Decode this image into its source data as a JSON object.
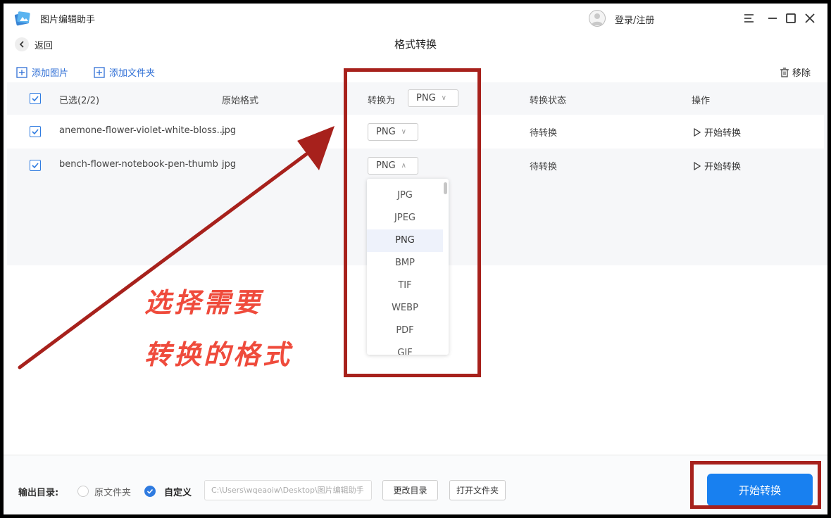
{
  "app": {
    "name": "图片编辑助手",
    "login": "登录/注册"
  },
  "header": {
    "back": "返回",
    "title": "格式转换"
  },
  "toolbar": {
    "add_image": "添加图片",
    "add_folder": "添加文件夹",
    "remove": "移除"
  },
  "table": {
    "headers": {
      "selected": "已选(2/2)",
      "orig_format": "原始格式",
      "convert_to": "转换为",
      "convert_to_value": "PNG",
      "status": "转换状态",
      "action": "操作"
    },
    "rows": [
      {
        "name": "anemone-flower-violet-white-bloss...",
        "format": "jpg",
        "target": "PNG",
        "status": "待转换",
        "action": "开始转换"
      },
      {
        "name": "bench-flower-notebook-pen-thumb",
        "format": "jpg",
        "target": "PNG",
        "status": "待转换",
        "action": "开始转换"
      }
    ]
  },
  "dropdown": {
    "options": [
      "JPG",
      "JPEG",
      "PNG",
      "BMP",
      "TIF",
      "WEBP",
      "PDF",
      "GIF"
    ],
    "selected": "PNG"
  },
  "annotation": {
    "line1": "选择需要",
    "line2": "转换的格式"
  },
  "footer": {
    "label": "输出目录:",
    "radio_original": "原文件夹",
    "radio_custom": "自定义",
    "path": "C:\\Users\\wqeaoiw\\Desktop\\图片编辑助手",
    "change_dir": "更改目录",
    "open_folder": "打开文件夹",
    "start": "开始转换"
  },
  "colors": {
    "accent": "#1880f0",
    "annotation_red": "#a7211c",
    "annotation_text": "#ef4b3c"
  }
}
